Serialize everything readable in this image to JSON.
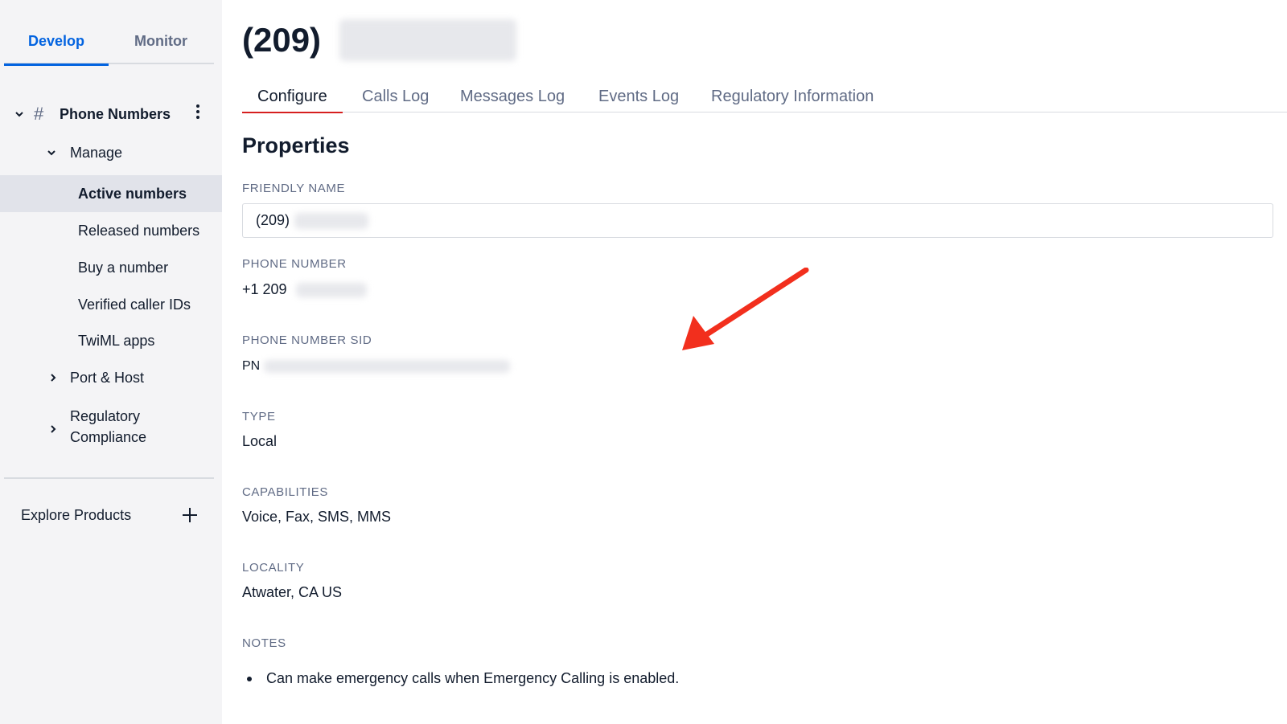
{
  "sidebar": {
    "tabs": [
      {
        "label": "Develop",
        "active": true
      },
      {
        "label": "Monitor",
        "active": false
      }
    ],
    "section": {
      "label": "Phone Numbers",
      "icon": "hash-icon"
    },
    "group": {
      "label": "Manage"
    },
    "items": [
      {
        "label": "Active numbers",
        "active": true
      },
      {
        "label": "Released numbers"
      },
      {
        "label": "Buy a number"
      },
      {
        "label": "Verified caller IDs"
      },
      {
        "label": "TwiML apps"
      }
    ],
    "collapsed": [
      {
        "label": "Port & Host"
      },
      {
        "label": "Regulatory",
        "label2": "Compliance"
      }
    ],
    "explore": {
      "label": "Explore Products"
    }
  },
  "page": {
    "title": "(209)",
    "tabs": [
      {
        "label": "Configure",
        "active": true
      },
      {
        "label": "Calls Log"
      },
      {
        "label": "Messages Log"
      },
      {
        "label": "Events Log"
      },
      {
        "label": "Regulatory Information"
      }
    ],
    "section_title": "Properties",
    "fields": {
      "friendly_name": {
        "label": "FRIENDLY NAME",
        "value": "(209)"
      },
      "phone_number": {
        "label": "PHONE NUMBER",
        "value": "+1 209"
      },
      "sid": {
        "label": "PHONE NUMBER SID",
        "value": "PN"
      },
      "type": {
        "label": "TYPE",
        "value": "Local"
      },
      "capabilities": {
        "label": "CAPABILITIES",
        "value": "Voice, Fax, SMS, MMS"
      },
      "locality": {
        "label": "LOCALITY",
        "value": "Atwater, CA US"
      },
      "notes": {
        "label": "NOTES",
        "items": [
          "Can make emergency calls when Emergency Calling is enabled."
        ]
      }
    }
  },
  "colors": {
    "accent": "#0263e0",
    "tab_underline": "#d61f1f",
    "annotation_arrow": "#f22f1d",
    "sidebar_bg": "#f4f4f6"
  }
}
